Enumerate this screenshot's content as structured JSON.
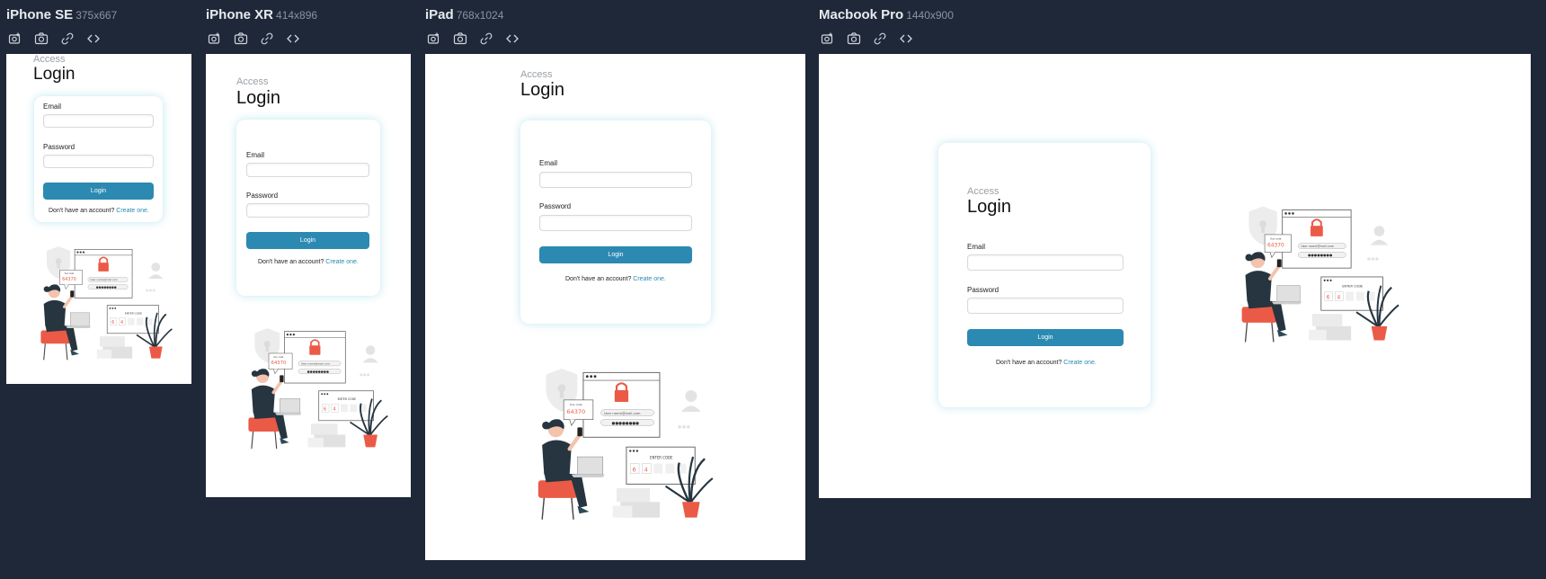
{
  "colors": {
    "background": "#1f2838",
    "accent": "#2c89b1",
    "illustration_accent": "#eb5a46"
  },
  "toolbar_icons": [
    "camera-plus-icon",
    "camera-icon",
    "link-icon",
    "code-icon"
  ],
  "devices": [
    {
      "name": "iPhone SE",
      "size": "375x667"
    },
    {
      "name": "iPhone XR",
      "size": "414x896"
    },
    {
      "name": "iPad",
      "size": "768x1024"
    },
    {
      "name": "Macbook Pro",
      "size": "1440x900"
    }
  ],
  "login": {
    "eyebrow": "Access",
    "title": "Login",
    "email_label": "Email",
    "password_label": "Password",
    "button_label": "Login",
    "signup_prompt": "Don't have an account?",
    "signup_link": "Create one."
  },
  "illustration": {
    "code_box_label": "Your code",
    "code_value": "64370",
    "email_value": "User name@mail.com",
    "password_mask": "●●●●●●●●",
    "enter_code_label": "ENTER CODE",
    "code_digits": [
      "6",
      "4"
    ]
  }
}
